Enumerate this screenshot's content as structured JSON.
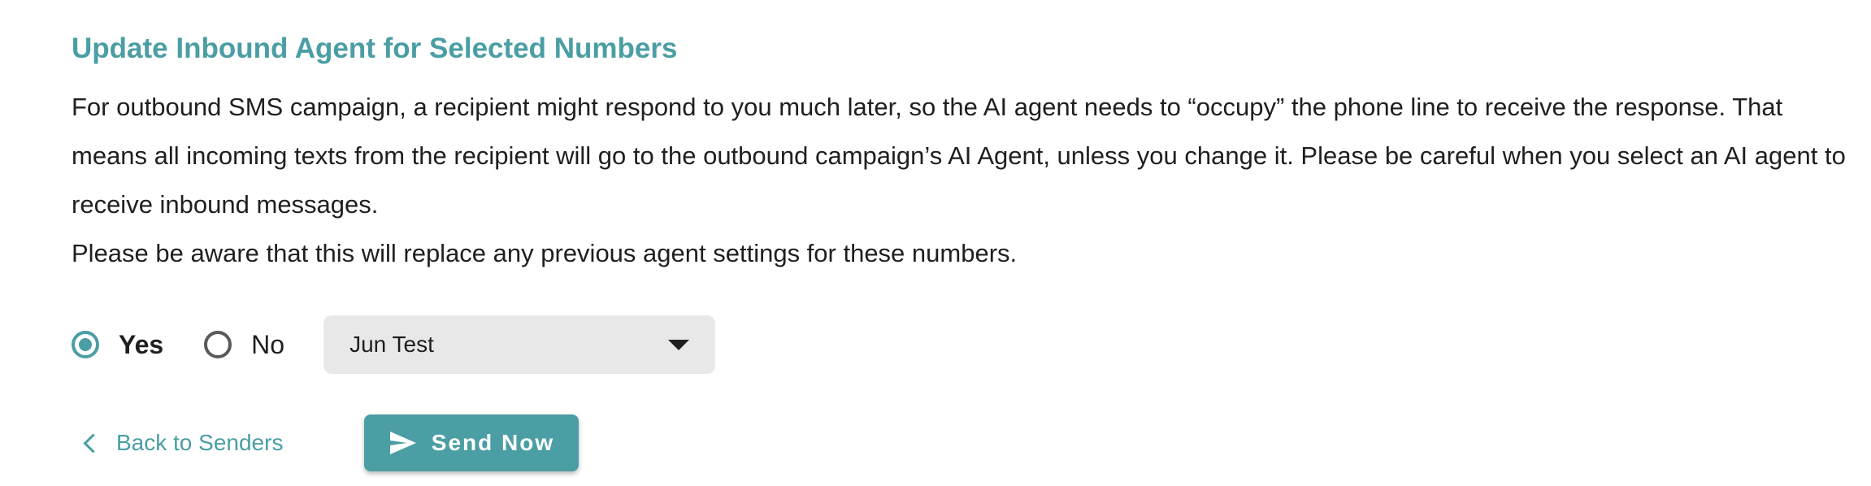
{
  "heading": "Update Inbound Agent for Selected Numbers",
  "description": "For outbound SMS campaign, a recipient might respond to you much later, so the AI agent needs to “occupy” the phone line to receive the response. That means all incoming texts from the recipient will go to the outbound campaign’s AI Agent, unless you change it. Please be careful when you select an AI agent to receive inbound messages.",
  "warning": "Please be aware that this will replace any previous agent settings for these numbers.",
  "options": {
    "yes_label": "Yes",
    "no_label": "No",
    "selected": "Yes"
  },
  "agent_select": {
    "value": "Jun Test",
    "icon": "caret-down-icon"
  },
  "actions": {
    "back_label": "Back to Senders",
    "back_icon": "chevron-left-icon",
    "send_label": "Send Now",
    "send_icon": "send-icon"
  },
  "colors": {
    "accent": "#4a9ea4",
    "text": "#1f1f1f",
    "select_bg": "#e8e8e8"
  }
}
